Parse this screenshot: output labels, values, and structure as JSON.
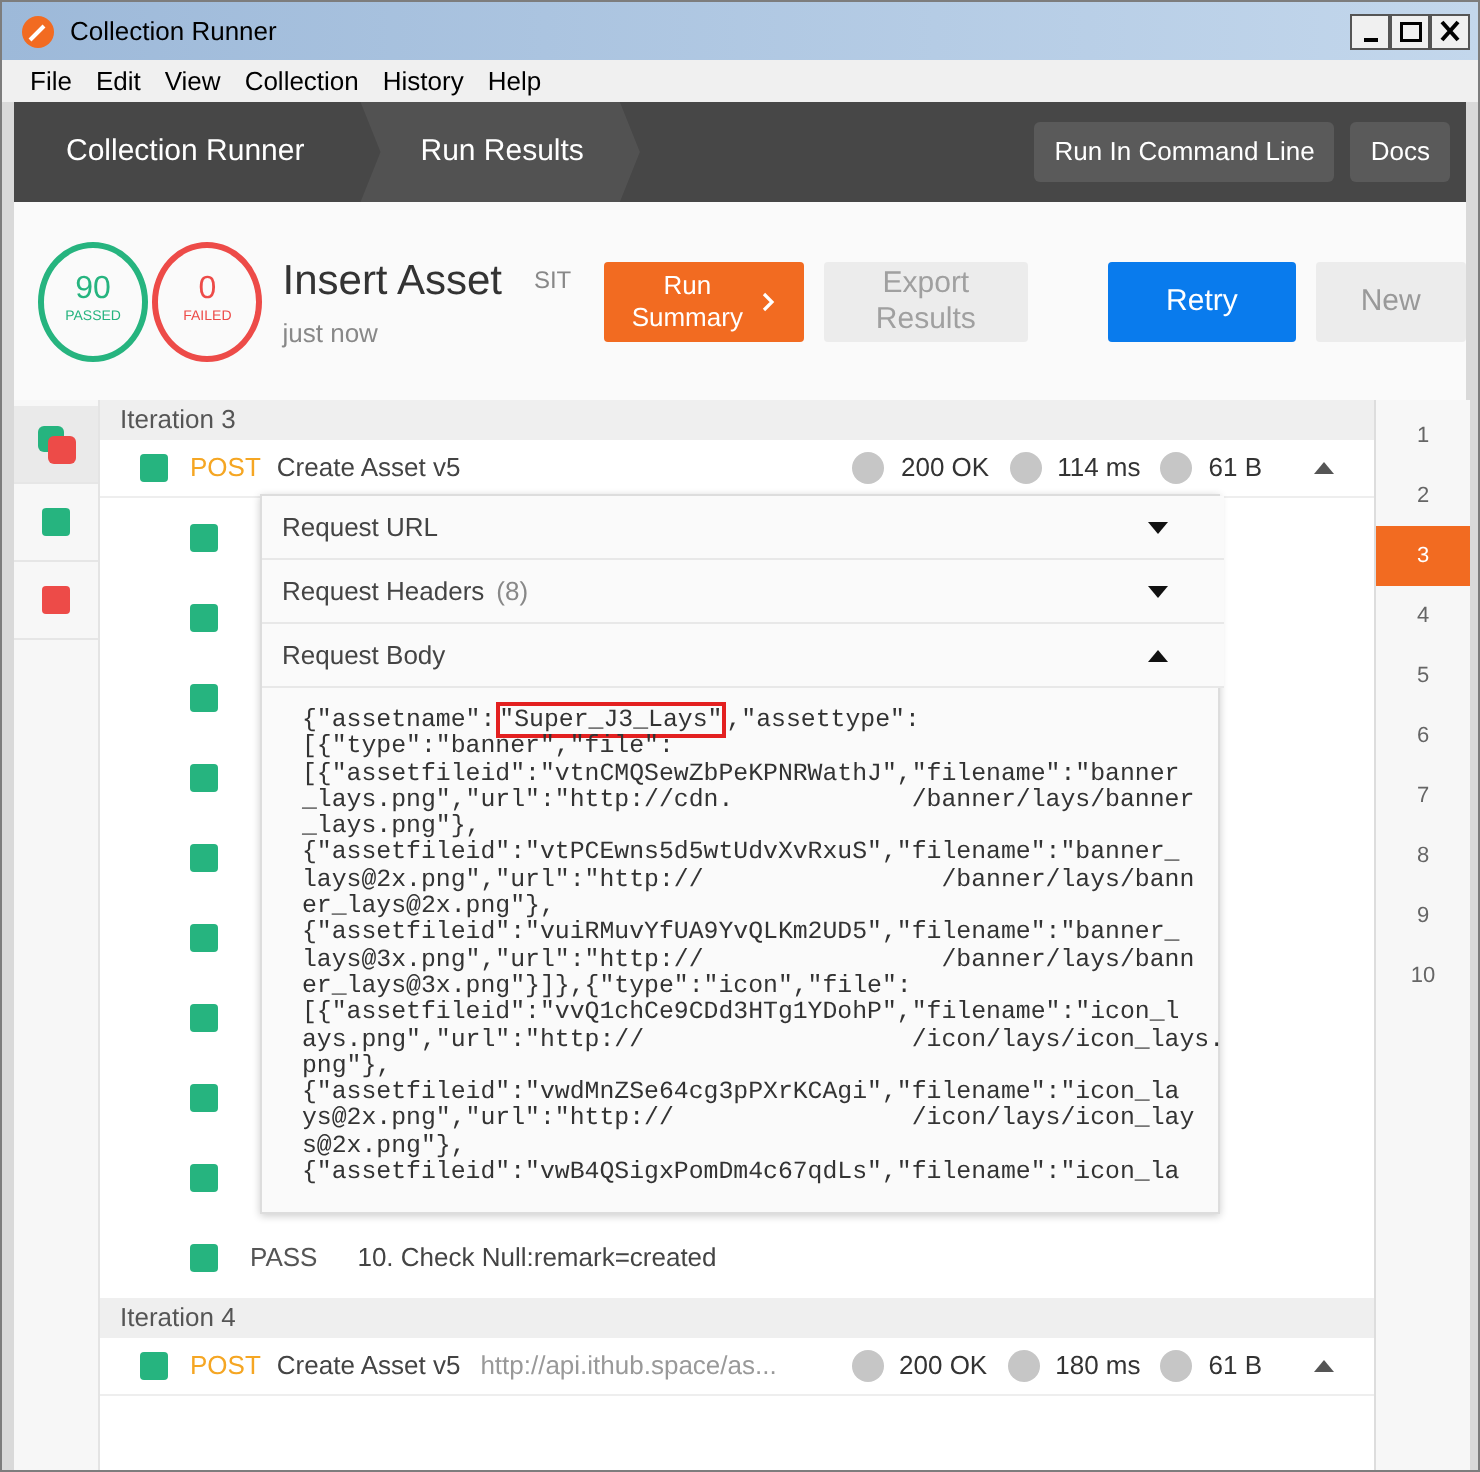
{
  "window": {
    "title": "Collection Runner"
  },
  "menu": [
    "File",
    "Edit",
    "View",
    "Collection",
    "History",
    "Help"
  ],
  "breadcrumbs": [
    {
      "label": "Collection Runner",
      "selected": false
    },
    {
      "label": "Run Results",
      "selected": true
    }
  ],
  "header_buttons": [
    "Run In Command Line",
    "Docs"
  ],
  "summary": {
    "counters": [
      {
        "count": "90",
        "label": "PASSED",
        "color": "#26b47f"
      },
      {
        "count": "0",
        "label": "FAILED",
        "color": "#ed4b48"
      }
    ],
    "name": "Insert Asset",
    "environment": "SIT",
    "time": "just now",
    "buttons": [
      {
        "label": "Run Summary",
        "kind": "orange"
      },
      {
        "label": "Export Results",
        "kind": "disabled"
      },
      {
        "label": "Retry",
        "kind": "blue"
      },
      {
        "label": "New",
        "kind": "light"
      }
    ]
  },
  "sidebar": [
    {
      "kind": "mixed",
      "selected": true
    },
    {
      "kind": "single",
      "color": "#26b47f",
      "selected": false
    },
    {
      "kind": "single",
      "color": "#ed4b48",
      "selected": false
    }
  ],
  "iteration_numbers": [
    {
      "label": "1",
      "selected": false
    },
    {
      "label": "2",
      "selected": false
    },
    {
      "label": "3",
      "selected": true
    },
    {
      "label": "4",
      "selected": false
    },
    {
      "label": "5",
      "selected": false
    },
    {
      "label": "6",
      "selected": false
    },
    {
      "label": "7",
      "selected": false
    },
    {
      "label": "8",
      "selected": false
    },
    {
      "label": "9",
      "selected": false
    },
    {
      "label": "10",
      "selected": false
    }
  ],
  "iterations": [
    {
      "title": "Iteration 3",
      "request": {
        "color": "#26b47f",
        "method": "POST",
        "name": "Create Asset v5",
        "code": "200 OK",
        "time": "114 ms",
        "size": "61 B",
        "expanded": true
      },
      "tests": [
        {
          "color": "#26b47f"
        },
        {
          "color": "#26b47f"
        },
        {
          "color": "#26b47f"
        },
        {
          "color": "#26b47f"
        },
        {
          "color": "#26b47f"
        },
        {
          "color": "#26b47f"
        },
        {
          "color": "#26b47f"
        },
        {
          "color": "#26b47f"
        },
        {
          "color": "#26b47f"
        },
        {
          "color": "#26b47f",
          "result": "PASS",
          "name": "10. Check Null:remark=created"
        }
      ]
    },
    {
      "title": "Iteration 4",
      "request": {
        "color": "#26b47f",
        "method": "POST",
        "name": "Create Asset v5",
        "url": "http://api.ithub.space/as...",
        "code": "200 OK",
        "time": "180 ms",
        "size": "61 B",
        "expanded": true
      }
    }
  ],
  "popover": {
    "sections": [
      {
        "label": "Request URL",
        "expanded": false
      },
      {
        "label": "Request Headers",
        "count": "(8)",
        "expanded": false
      },
      {
        "label": "Request Body",
        "expanded": true
      }
    ],
    "body_lines": [
      {
        "text": "{\"assetname\":",
        "boxed": "\"Super_J3_Lays\"",
        "after": ",\"assettype\":"
      },
      {
        "text": "[{\"type\":\"banner\",\"file\":"
      },
      {
        "text": "[{\"assetfileid\":\"vtnCMQSewZbPeKPNRWathJ\",\"filename\":\"banner"
      },
      {
        "text": "_lays.png\",\"url\":\"http://cdn.            /banner/lays/banner"
      },
      {
        "text": "_lays.png\"},"
      },
      {
        "text": "{\"assetfileid\":\"vtPCEwns5d5wtUdvXvRxuS\",\"filename\":\"banner_"
      },
      {
        "text": "lays@2x.png\",\"url\":\"http://                /banner/lays/bann"
      },
      {
        "text": "er_lays@2x.png\"},"
      },
      {
        "text": "{\"assetfileid\":\"vuiRMuvYfUA9YvQLKm2UD5\",\"filename\":\"banner_"
      },
      {
        "text": "lays@3x.png\",\"url\":\"http://                /banner/lays/bann"
      },
      {
        "text": "er_lays@3x.png\"}]},{\"type\":\"icon\",\"file\":"
      },
      {
        "text": "[{\"assetfileid\":\"vvQ1chCe9CDd3HTg1YDohP\",\"filename\":\"icon_l"
      },
      {
        "text": "ays.png\",\"url\":\"http://                  /icon/lays/icon_lays."
      },
      {
        "text": "png\"},"
      },
      {
        "text": "{\"assetfileid\":\"vwdMnZSe64cg3pPXrKCAgi\",\"filename\":\"icon_la"
      },
      {
        "text": "ys@2x.png\",\"url\":\"http://                /icon/lays/icon_lay"
      },
      {
        "text": "s@2x.png\"},"
      },
      {
        "text": "{\"assetfileid\":\"vwB4QSigxPomDm4c67qdLs\",\"filename\":\"icon_la"
      }
    ]
  }
}
